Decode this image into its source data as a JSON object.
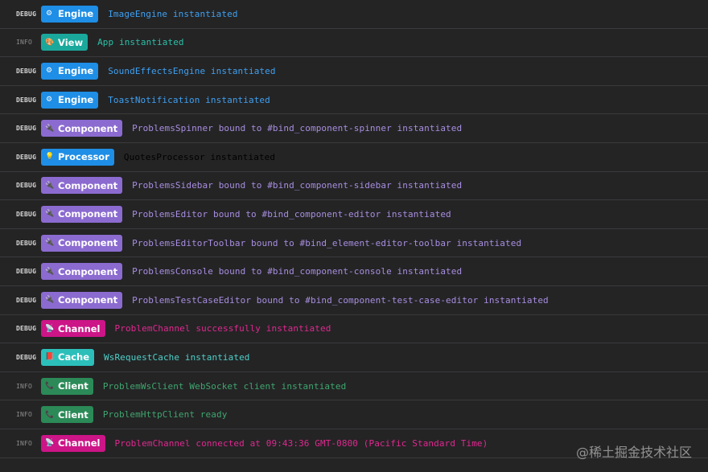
{
  "colors": {
    "engine": "#1e8ee6",
    "view": "#1ba89c",
    "component": "#8b6bd0",
    "processor": "#1e8ee6",
    "channel": "#cc1587",
    "cache": "#2cbfba",
    "client": "#2b8a57",
    "engine_text": "#3fa0f0",
    "view_text": "#2cc0a6",
    "component_text": "#a88ee0",
    "channel_text": "#e0288f",
    "cache_text": "#4fd0c8",
    "client_text": "#3fa66e"
  },
  "logs": [
    {
      "level": "DEBUG",
      "tag": "Engine",
      "icon": "gear-icon",
      "glyph": "⚙",
      "message": "ImageEngine instantiated"
    },
    {
      "level": "INFO",
      "tag": "View",
      "icon": "palette-icon",
      "glyph": "🎨",
      "message": "App instantiated"
    },
    {
      "level": "DEBUG",
      "tag": "Engine",
      "icon": "gear-icon",
      "glyph": "⚙",
      "message": "SoundEffectsEngine instantiated"
    },
    {
      "level": "DEBUG",
      "tag": "Engine",
      "icon": "gear-icon",
      "glyph": "⚙",
      "message": "ToastNotification instantiated"
    },
    {
      "level": "DEBUG",
      "tag": "Component",
      "icon": "plug-icon",
      "glyph": "🔌",
      "message": "ProblemsSpinner bound to #bind_component-spinner instantiated"
    },
    {
      "level": "DEBUG",
      "tag": "Processor",
      "icon": "lightbulb-icon",
      "glyph": "💡",
      "message": "QuotesProcessor instantiated"
    },
    {
      "level": "DEBUG",
      "tag": "Component",
      "icon": "plug-icon",
      "glyph": "🔌",
      "message": "ProblemsSidebar bound to #bind_component-sidebar instantiated"
    },
    {
      "level": "DEBUG",
      "tag": "Component",
      "icon": "plug-icon",
      "glyph": "🔌",
      "message": "ProblemsEditor bound to #bind_component-editor instantiated"
    },
    {
      "level": "DEBUG",
      "tag": "Component",
      "icon": "plug-icon",
      "glyph": "🔌",
      "message": "ProblemsEditorToolbar bound to #bind_element-editor-toolbar instantiated"
    },
    {
      "level": "DEBUG",
      "tag": "Component",
      "icon": "plug-icon",
      "glyph": "🔌",
      "message": "ProblemsConsole bound to #bind_component-console instantiated"
    },
    {
      "level": "DEBUG",
      "tag": "Component",
      "icon": "plug-icon",
      "glyph": "🔌",
      "message": "ProblemsTestCaseEditor bound to #bind_component-test-case-editor instantiated"
    },
    {
      "level": "DEBUG",
      "tag": "Channel",
      "icon": "satellite-icon",
      "glyph": "📡",
      "message": "ProblemChannel successfully instantiated"
    },
    {
      "level": "DEBUG",
      "tag": "Cache",
      "icon": "book-icon",
      "glyph": "📕",
      "message": "WsRequestCache instantiated"
    },
    {
      "level": "INFO",
      "tag": "Client",
      "icon": "phone-icon",
      "glyph": "📞",
      "message": "ProblemWsClient WebSocket client instantiated"
    },
    {
      "level": "INFO",
      "tag": "Client",
      "icon": "phone-icon",
      "glyph": "📞",
      "message": "ProblemHttpClient ready"
    },
    {
      "level": "INFO",
      "tag": "Channel",
      "icon": "satellite-icon",
      "glyph": "📡",
      "message": "ProblemChannel connected at 09:43:36 GMT-0800 (Pacific Standard Time)"
    }
  ],
  "watermark": "@稀土掘金技术社区"
}
